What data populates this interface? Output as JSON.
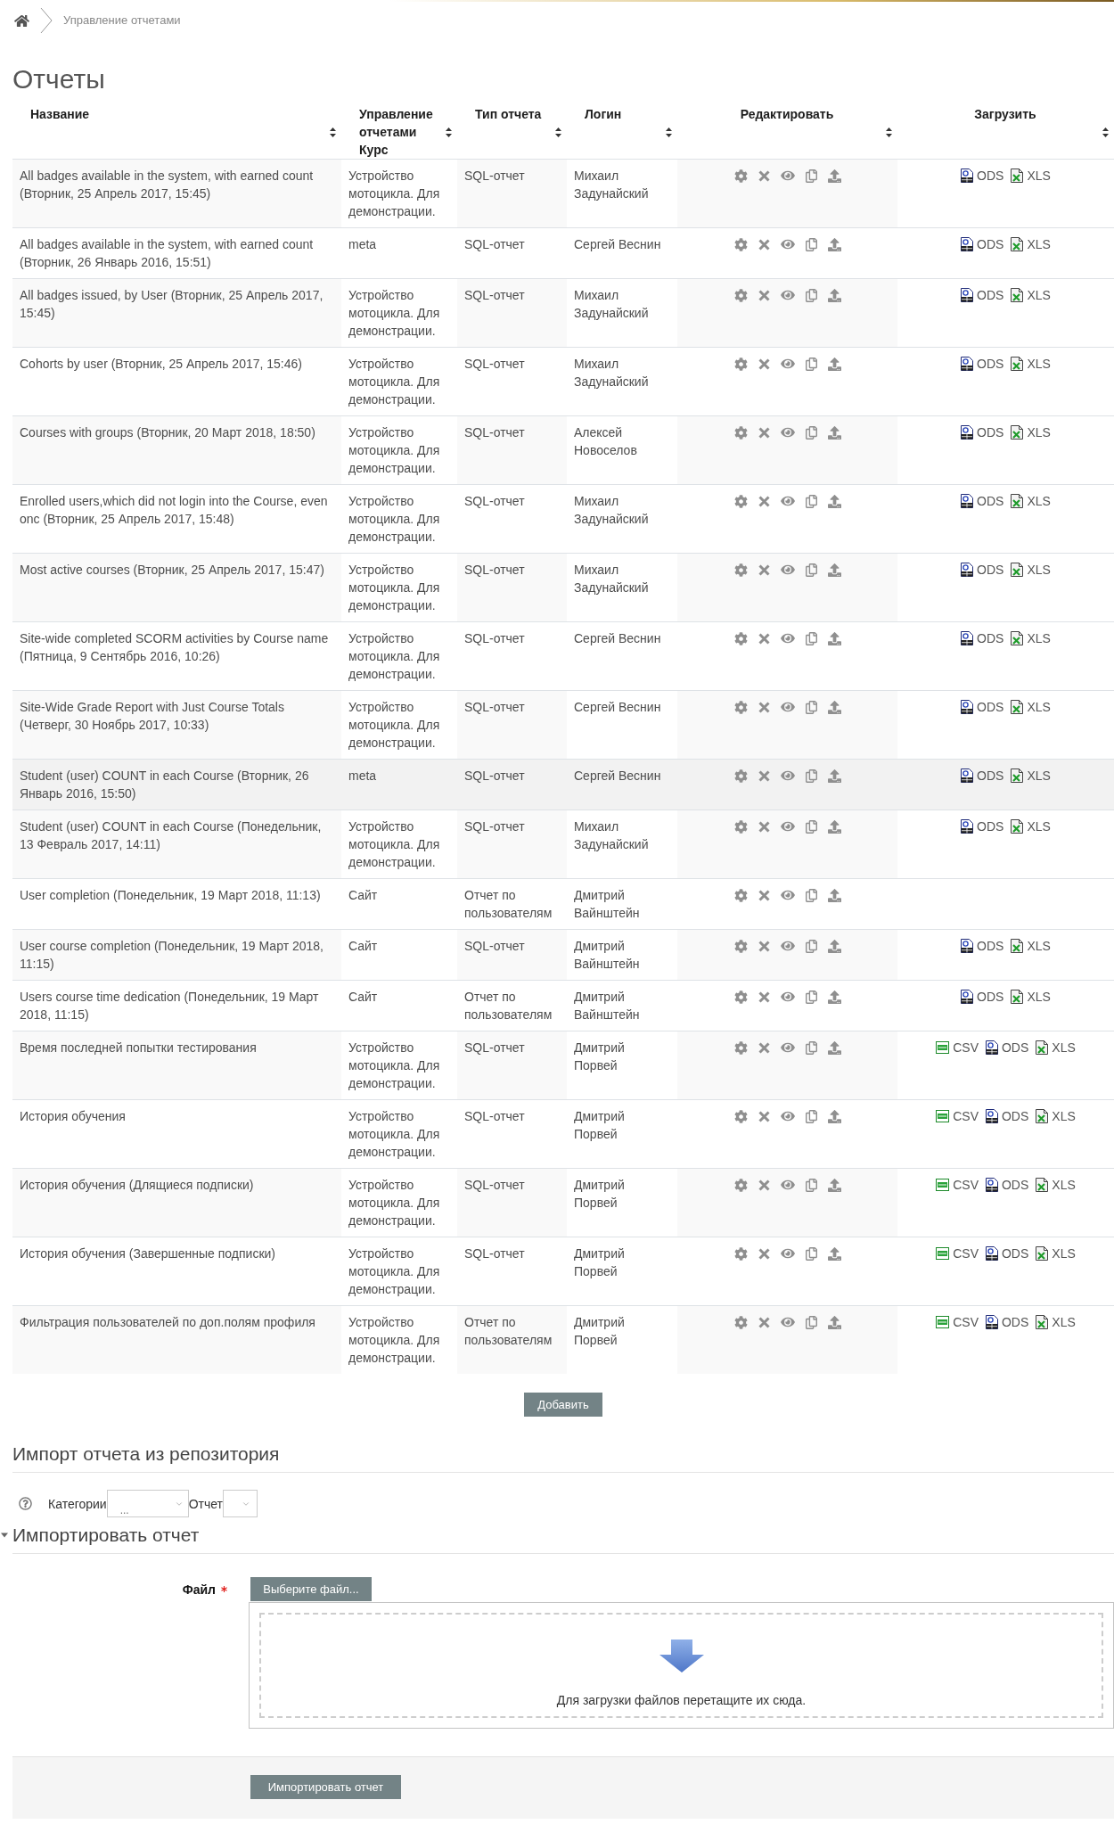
{
  "breadcrumb": {
    "items": [
      "Управление отчетами"
    ]
  },
  "page_title": "Отчеты",
  "table": {
    "columns": [
      "Название",
      "Управление отчетами Курс",
      "Тип отчета",
      "Логин",
      "Редактировать",
      "Загрузить"
    ],
    "rows": [
      {
        "name": "All badges available in the system, with earned count (Вторник, 25 Апрель 2017, 15:45)",
        "course": "Устройство мотоцикла. Для демонстрации.",
        "type": "SQL-отчет",
        "login": "Михаил Задунайский",
        "hovered": false,
        "downloads": [
          {
            "kind": "ods",
            "label": "ODS"
          },
          {
            "kind": "xls",
            "label": "XLS"
          }
        ]
      },
      {
        "name": "All badges available in the system, with earned count (Вторник, 26 Январь 2016, 15:51)",
        "course": "meta",
        "type": "SQL-отчет",
        "login": "Сергей Веснин",
        "hovered": false,
        "downloads": [
          {
            "kind": "ods",
            "label": "ODS"
          },
          {
            "kind": "xls",
            "label": "XLS"
          }
        ]
      },
      {
        "name": "All badges issued, by User (Вторник, 25 Апрель 2017, 15:45)",
        "course": "Устройство мотоцикла. Для демонстрации.",
        "type": "SQL-отчет",
        "login": "Михаил Задунайский",
        "hovered": false,
        "downloads": [
          {
            "kind": "ods",
            "label": "ODS"
          },
          {
            "kind": "xls",
            "label": "XLS"
          }
        ]
      },
      {
        "name": "Cohorts by user (Вторник, 25 Апрель 2017, 15:46)",
        "course": "Устройство мотоцикла. Для демонстрации.",
        "type": "SQL-отчет",
        "login": "Михаил Задунайский",
        "hovered": false,
        "downloads": [
          {
            "kind": "ods",
            "label": "ODS"
          },
          {
            "kind": "xls",
            "label": "XLS"
          }
        ]
      },
      {
        "name": "Courses with groups (Вторник, 20 Март 2018, 18:50)",
        "course": "Устройство мотоцикла. Для демонстрации.",
        "type": "SQL-отчет",
        "login": "Алексей Новоселов",
        "hovered": false,
        "downloads": [
          {
            "kind": "ods",
            "label": "ODS"
          },
          {
            "kind": "xls",
            "label": "XLS"
          }
        ]
      },
      {
        "name": "Enrolled users,which did not login into the Course, even onc (Вторник, 25 Апрель 2017, 15:48)",
        "course": "Устройство мотоцикла. Для демонстрации.",
        "type": "SQL-отчет",
        "login": "Михаил Задунайский",
        "hovered": false,
        "downloads": [
          {
            "kind": "ods",
            "label": "ODS"
          },
          {
            "kind": "xls",
            "label": "XLS"
          }
        ]
      },
      {
        "name": "Most active courses (Вторник, 25 Апрель 2017, 15:47)",
        "course": "Устройство мотоцикла. Для демонстрации.",
        "type": "SQL-отчет",
        "login": "Михаил Задунайский",
        "hovered": false,
        "downloads": [
          {
            "kind": "ods",
            "label": "ODS"
          },
          {
            "kind": "xls",
            "label": "XLS"
          }
        ]
      },
      {
        "name": "Site-wide completed SCORM activities by Course name (Пятница, 9 Сентябрь 2016, 10:26)",
        "course": "Устройство мотоцикла. Для демонстрации.",
        "type": "SQL-отчет",
        "login": "Сергей Веснин",
        "hovered": false,
        "downloads": [
          {
            "kind": "ods",
            "label": "ODS"
          },
          {
            "kind": "xls",
            "label": "XLS"
          }
        ]
      },
      {
        "name": "Site-Wide Grade Report with Just Course Totals (Четверг, 30 Ноябрь 2017, 10:33)",
        "course": "Устройство мотоцикла. Для демонстрации.",
        "type": "SQL-отчет",
        "login": "Сергей Веснин",
        "hovered": false,
        "downloads": [
          {
            "kind": "ods",
            "label": "ODS"
          },
          {
            "kind": "xls",
            "label": "XLS"
          }
        ]
      },
      {
        "name": "Student (user) COUNT in each Course (Вторник, 26 Январь 2016, 15:50)",
        "course": "meta",
        "type": "SQL-отчет",
        "login": "Сергей Веснин",
        "hovered": true,
        "downloads": [
          {
            "kind": "ods",
            "label": "ODS"
          },
          {
            "kind": "xls",
            "label": "XLS"
          }
        ]
      },
      {
        "name": "Student (user) COUNT in each Course (Понедельник, 13 Февраль 2017, 14:11)",
        "course": "Устройство мотоцикла. Для демонстрации.",
        "type": "SQL-отчет",
        "login": "Михаил Задунайский",
        "hovered": false,
        "downloads": [
          {
            "kind": "ods",
            "label": "ODS"
          },
          {
            "kind": "xls",
            "label": "XLS"
          }
        ]
      },
      {
        "name": "User completion (Понедельник, 19 Март 2018, 11:13)",
        "course": "Сайт",
        "type": "Отчет по пользователям",
        "login": "Дмитрий Вайнштейн",
        "hovered": false
      },
      {
        "name": "User course completion (Понедельник, 19 Март 2018, 11:15)",
        "course": "Сайт",
        "type": "SQL-отчет",
        "login": "Дмитрий Вайнштейн",
        "hovered": false,
        "downloads": [
          {
            "kind": "ods",
            "label": "ODS"
          },
          {
            "kind": "xls",
            "label": "XLS"
          }
        ]
      },
      {
        "name": "Users course time dedication (Понедельник, 19 Март 2018, 11:15)",
        "course": "Сайт",
        "type": "Отчет по пользователям",
        "login": "Дмитрий Вайнштейн",
        "hovered": false,
        "downloads": [
          {
            "kind": "ods",
            "label": "ODS"
          },
          {
            "kind": "xls",
            "label": "XLS"
          }
        ]
      },
      {
        "name": "Время последней попытки тестирования",
        "course": "Устройство мотоцикла. Для демонстрации.",
        "type": "SQL-отчет",
        "login": "Дмитрий Порвей",
        "hovered": false,
        "downloads": [
          {
            "kind": "csv",
            "label": "CSV"
          },
          {
            "kind": "ods",
            "label": "ODS"
          },
          {
            "kind": "xls",
            "label": "XLS"
          }
        ]
      },
      {
        "name": "История обучения",
        "course": "Устройство мотоцикла. Для демонстрации.",
        "type": "SQL-отчет",
        "login": "Дмитрий Порвей",
        "hovered": false,
        "downloads": [
          {
            "kind": "csv",
            "label": "CSV"
          },
          {
            "kind": "ods",
            "label": "ODS"
          },
          {
            "kind": "xls",
            "label": "XLS"
          }
        ]
      },
      {
        "name": "История обучения (Длящиеся подписки)",
        "course": "Устройство мотоцикла. Для демонстрации.",
        "type": "SQL-отчет",
        "login": "Дмитрий Порвей",
        "hovered": false,
        "downloads": [
          {
            "kind": "csv",
            "label": "CSV"
          },
          {
            "kind": "ods",
            "label": "ODS"
          },
          {
            "kind": "xls",
            "label": "XLS"
          }
        ]
      },
      {
        "name": "История обучения (Завершенные подписки)",
        "course": "Устройство мотоцикла. Для демонстрации.",
        "type": "SQL-отчет",
        "login": "Дмитрий Порвей",
        "hovered": false,
        "downloads": [
          {
            "kind": "csv",
            "label": "CSV"
          },
          {
            "kind": "ods",
            "label": "ODS"
          },
          {
            "kind": "xls",
            "label": "XLS"
          }
        ]
      },
      {
        "name": "Фильтрация пользователей по доп.полям профиля",
        "course": "Устройство мотоцикла. Для демонстрации.",
        "type": "Отчет по пользователям",
        "login": "Дмитрий Порвей",
        "hovered": false,
        "downloads": [
          {
            "kind": "csv",
            "label": "CSV"
          },
          {
            "kind": "ods",
            "label": "ODS"
          },
          {
            "kind": "xls",
            "label": "XLS"
          }
        ]
      }
    ]
  },
  "add_button": "Добавить",
  "repository_import": {
    "heading": "Импорт отчета из репозитория",
    "category_label": "Категории",
    "category_value": "...",
    "report_label": "Отчет"
  },
  "import_form": {
    "heading": "Импортировать отчет",
    "expanded": true,
    "file_label": "Файл",
    "required": true,
    "choose_button": "Выберите файл...",
    "drop_hint": "Для загрузки файлов перетащите их сюда.",
    "submit_button": "Импортировать отчет"
  }
}
